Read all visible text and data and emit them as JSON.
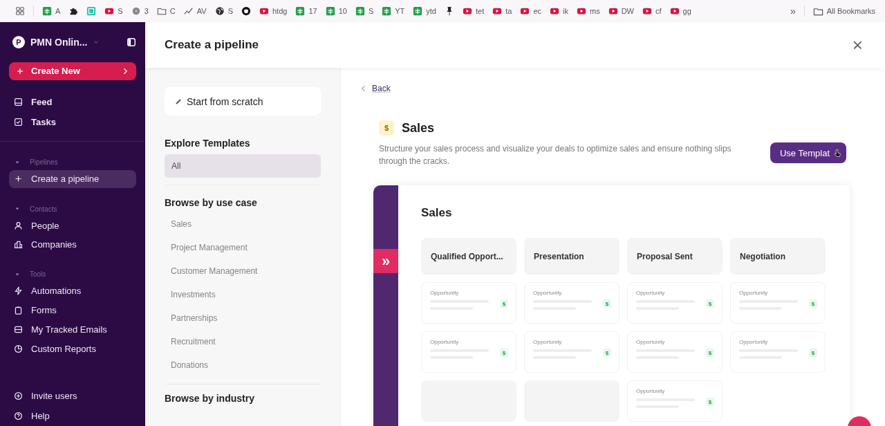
{
  "bookmarks": {
    "items": [
      {
        "kind": "apps"
      },
      {
        "kind": "sheet",
        "label": "A"
      },
      {
        "kind": "puzzle"
      },
      {
        "kind": "app"
      },
      {
        "kind": "video",
        "label": "S"
      },
      {
        "kind": "disc",
        "label": "3"
      },
      {
        "kind": "folder",
        "label": "C"
      },
      {
        "kind": "chart",
        "label": "AV"
      },
      {
        "kind": "globe",
        "label": "S"
      },
      {
        "kind": "github"
      },
      {
        "kind": "video",
        "label": "htdg"
      },
      {
        "kind": "sheet",
        "label": "17"
      },
      {
        "kind": "sheet",
        "label": "10"
      },
      {
        "kind": "sheet",
        "label": "S"
      },
      {
        "kind": "sheet",
        "label": "YT"
      },
      {
        "kind": "sheet",
        "label": "ytd"
      },
      {
        "kind": "pin"
      },
      {
        "kind": "video",
        "label": "tet"
      },
      {
        "kind": "video",
        "label": "ta"
      },
      {
        "kind": "video",
        "label": "ec"
      },
      {
        "kind": "video",
        "label": "ik"
      },
      {
        "kind": "video",
        "label": "ms"
      },
      {
        "kind": "video",
        "label": "DW"
      },
      {
        "kind": "video",
        "label": "cf"
      },
      {
        "kind": "video",
        "label": "gg"
      }
    ],
    "more": "»",
    "all": "All Bookmarks"
  },
  "sidebar": {
    "workspace": {
      "avatar": "P",
      "name": "PMN Onlin..."
    },
    "create_button": "Create New",
    "top_items": [
      {
        "kind": "feed",
        "label": "Feed",
        "selected": false
      },
      {
        "kind": "tasks",
        "label": "Tasks",
        "selected": false
      }
    ],
    "sections": [
      {
        "title": "Pipelines",
        "expanded": true,
        "items": [
          {
            "kind": "plus",
            "label": "Create a pipeline",
            "selected": true
          }
        ]
      },
      {
        "title": "Contacts",
        "expanded": true,
        "items": [
          {
            "kind": "person",
            "label": "People",
            "selected": false
          },
          {
            "kind": "building",
            "label": "Companies",
            "selected": false
          }
        ]
      },
      {
        "title": "Tools",
        "expanded": true,
        "items": [
          {
            "kind": "bolt",
            "label": "Automations",
            "selected": false
          },
          {
            "kind": "form",
            "label": "Forms",
            "selected": false
          },
          {
            "kind": "mail",
            "label": "My Tracked Emails",
            "selected": false
          },
          {
            "kind": "report",
            "label": "Custom Reports",
            "selected": false
          }
        ]
      }
    ],
    "bottom_items": [
      {
        "kind": "invite",
        "label": "Invite users",
        "selected": false
      },
      {
        "kind": "help",
        "label": "Help",
        "selected": false
      }
    ]
  },
  "dialog": {
    "title": "Create a pipeline",
    "close": "×"
  },
  "templates": {
    "scratch": "Start from scratch",
    "explore_title": "Explore Templates",
    "explore_items": [
      {
        "label": "All",
        "selected": true
      }
    ],
    "use_case_title": "Browse by use case",
    "use_cases": [
      {
        "label": "Sales",
        "selected": false
      },
      {
        "label": "Project Management",
        "selected": false
      },
      {
        "label": "Customer Management",
        "selected": false
      },
      {
        "label": "Investments",
        "selected": false
      },
      {
        "label": "Partnerships",
        "selected": false
      },
      {
        "label": "Recruitment",
        "selected": false
      },
      {
        "label": "Donations",
        "selected": false
      }
    ],
    "industry_title": "Browse by industry"
  },
  "detail": {
    "back": "Back",
    "icon_text": "$",
    "title": "Sales",
    "description": "Structure your sales process and visualize your deals to optimize sales and ensure nothing slips through the cracks.",
    "use_button": "Use Templat",
    "preview": {
      "expand": "»",
      "title": "Sales",
      "columns": [
        {
          "title": "Qualified Opport...",
          "cards": [
            {
              "kind": "card",
              "label": "Opportunity",
              "badge": "$"
            },
            {
              "kind": "card",
              "label": "Opportunity",
              "badge": "$"
            },
            {
              "kind": "placeholder"
            }
          ]
        },
        {
          "title": "Presentation",
          "cards": [
            {
              "kind": "card",
              "label": "Opportunity",
              "badge": "$"
            },
            {
              "kind": "card",
              "label": "Opportunity",
              "badge": "$"
            },
            {
              "kind": "placeholder"
            }
          ]
        },
        {
          "title": "Proposal Sent",
          "cards": [
            {
              "kind": "card",
              "label": "Opportunity",
              "badge": "$"
            },
            {
              "kind": "card",
              "label": "Opportunity",
              "badge": "$"
            },
            {
              "kind": "card",
              "label": "Opportunity",
              "badge": "$"
            }
          ]
        },
        {
          "title": "Negotiation",
          "cards": [
            {
              "kind": "card",
              "label": "Opportunity",
              "badge": "$"
            },
            {
              "kind": "card",
              "label": "Opportunity",
              "badge": "$"
            }
          ]
        }
      ]
    }
  }
}
